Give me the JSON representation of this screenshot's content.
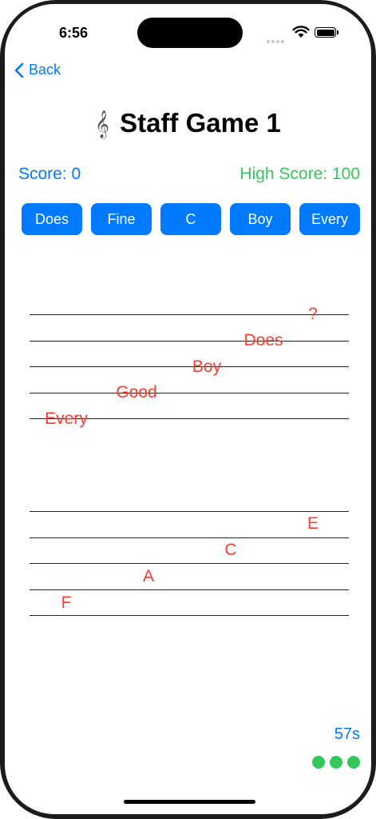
{
  "status_bar": {
    "time": "6:56"
  },
  "nav": {
    "back_label": "Back"
  },
  "header": {
    "clef": "𝄞",
    "title": "Staff Game 1"
  },
  "scores": {
    "score": "Score: 0",
    "high_score": "High Score: 100"
  },
  "answers": [
    "Does",
    "Fine",
    "C",
    "Boy",
    "Every"
  ],
  "staff_lines": {
    "question": "?",
    "labels": [
      "Does",
      "Boy",
      "Good",
      "Every"
    ]
  },
  "staff_spaces": {
    "labels": [
      "E",
      "C",
      "A",
      "F"
    ]
  },
  "timer": "57s",
  "lives": 3,
  "colors": {
    "accent": "#007aff",
    "success": "#34c759",
    "note": "#ff3b30"
  }
}
